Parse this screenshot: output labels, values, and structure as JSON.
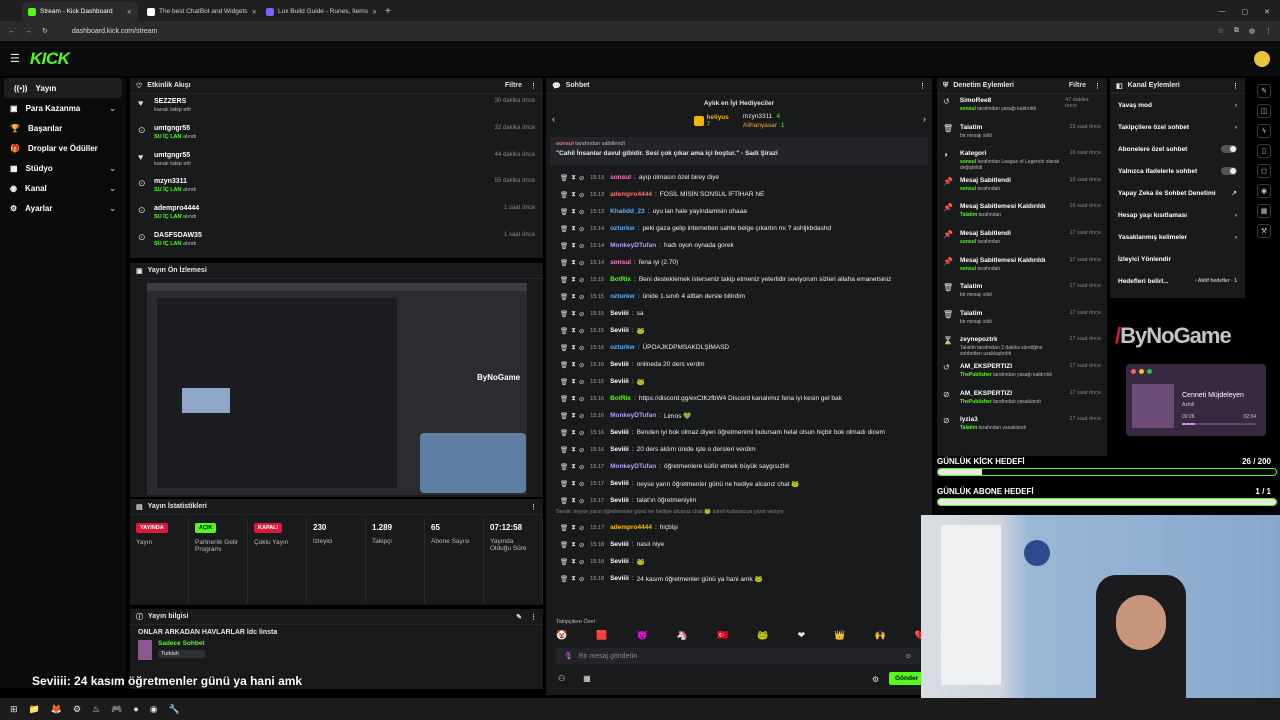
{
  "browser": {
    "tabs": [
      {
        "label": "Stream - Kick Dashboard",
        "color": "#53fc18"
      },
      {
        "label": "The best ChatBot and Widgets",
        "color": "#ffffff"
      },
      {
        "label": "Lux Build Guide - Runes, Items",
        "color": "#7b61ff"
      }
    ],
    "url": "dashboard.kick.com/stream"
  },
  "app": {
    "logo": "KICK"
  },
  "nav": [
    {
      "label": "Yayın",
      "icon": "broadcast-icon",
      "glyph": "((•))",
      "chev": ""
    },
    {
      "label": "Para Kazanma",
      "icon": "money-icon",
      "glyph": "▣",
      "chev": "⌄"
    },
    {
      "label": "Başarılar",
      "icon": "trophy-icon",
      "glyph": "🏆",
      "chev": ""
    },
    {
      "label": "Droplar ve Ödüller",
      "icon": "gift-icon",
      "glyph": "🎁",
      "chev": ""
    },
    {
      "label": "Stüdyo",
      "icon": "studio-icon",
      "glyph": "▦",
      "chev": "⌄"
    },
    {
      "label": "Kanal",
      "icon": "channel-icon",
      "glyph": "◉",
      "chev": "⌄"
    },
    {
      "label": "Ayarlar",
      "icon": "gear-icon",
      "glyph": "⚙",
      "chev": "⌄"
    }
  ],
  "activity": {
    "title": "Etkinlik Akışı",
    "filter": "Filtre",
    "items": [
      {
        "user": "SEZZERS",
        "action": "kanalı takip etti",
        "time": "30 dakika önce",
        "icon": "♥",
        "green": false
      },
      {
        "user": "umtgngr55",
        "action": "SU İÇ LAN",
        "action2": "alındı",
        "time": "32 dakika önce",
        "icon": "⊙",
        "green": true
      },
      {
        "user": "umtgngr55",
        "action": "kanalı takip etti",
        "time": "44 dakika önce",
        "icon": "♥",
        "green": false
      },
      {
        "user": "mzyn3311",
        "action": "SU İÇ LAN",
        "action2": "alındı",
        "time": "55 dakika önce",
        "icon": "⊙",
        "green": true
      },
      {
        "user": "adempro4444",
        "action": "SU İÇ LAN",
        "action2": "alındı",
        "time": "1 saat önce",
        "icon": "⊙",
        "green": true
      },
      {
        "user": "DASFSDAW35",
        "action": "SU İÇ LAN",
        "action2": "alındı",
        "time": "1 saat önce",
        "icon": "⊙",
        "green": true
      }
    ]
  },
  "preview": {
    "title": "Yayın Ön İzlemesi",
    "watermark": "ByNoGame"
  },
  "stats": {
    "title": "Yayın İstatistikleri",
    "boxes": [
      {
        "badge": "YAYINDA",
        "label": "Yayın",
        "color": "red"
      },
      {
        "badge": "AÇIK",
        "label": "Partnerlik Gelir Programı",
        "color": "grn"
      },
      {
        "badge": "KAPALI",
        "label": "Çoklu Yayın",
        "color": "red"
      },
      {
        "value": "230",
        "label": "İzleyici"
      },
      {
        "value": "1.289",
        "label": "Takipçi"
      },
      {
        "value": "65",
        "label": "Abone Sayısı"
      },
      {
        "value": "07:12:58",
        "label": "Yayında Olduğu Süre"
      }
    ]
  },
  "info": {
    "title": "Yayın bilgisi",
    "stream_title": "ONLAR ARKADAN HAVLARLAR ldc linsta",
    "category": "Sadece Sohbet",
    "tag": "Turkish"
  },
  "overlay_chat": {
    "user": "Seviiii",
    "text": ": 24 kasım öğretmenler günü ya hani amk"
  },
  "chat": {
    "title": "Sohbet",
    "gifters_title": "Aylık en İyi Hediyeciler",
    "gifters": [
      {
        "name": "heliyus",
        "value": "7"
      },
      {
        "name": "mzyn3311",
        "value": "4"
      },
      {
        "name": "Alihanyasar",
        "value": "1"
      }
    ],
    "pinned_by": "sonsul",
    "pinned_by_suffix": "tarafından sabitlendi",
    "pinned_msg": "\"Cahil İnsanlar davul gibidir. Sesi çok çıkar ama içi boştur.\" - Sadi Şirazi",
    "messages": [
      {
        "time": "15:13",
        "user": "sonsul",
        "color": "#ff7dd6",
        "msg": "ayıp olmasın özel birey diye"
      },
      {
        "time": "15:13",
        "user": "adempro4444",
        "color": "#ff7070",
        "msg": "FOSİL MİSİN SONSUL İFTİHAR NE"
      },
      {
        "time": "15:13",
        "user": "Khalidd_23",
        "color": "#56b4ff",
        "msg": "uyu lan hale yayindamisin ohaaa"
      },
      {
        "time": "15:14",
        "user": "ozturkw",
        "color": "#56b4ff",
        "msg": "peki gaza gelip internetten sahte belge çıkartın mı ? ashljkbdashd"
      },
      {
        "time": "15:14",
        "user": "MonkeyDTufan",
        "color": "#b79cff",
        "msg": "hadı oyun oynada gorek"
      },
      {
        "time": "15:14",
        "user": "sonsul",
        "color": "#ff7dd6",
        "msg": "fena iyi (2.70)"
      },
      {
        "time": "15:15",
        "user": "BotRix",
        "color": "#53fc18",
        "msg": "Beni desteklemek isterseniz takip etmeniz yeterlidir seviyorum sizleri allaha emanetsiniz"
      },
      {
        "time": "15:15",
        "user": "ozturkw",
        "color": "#56b4ff",
        "msg": "ünide 1.sınıfı 4 alttan dersle bitirdim"
      },
      {
        "time": "15:15",
        "user": "Seviiii",
        "color": "#ffffff",
        "msg": "sa"
      },
      {
        "time": "15:15",
        "user": "Seviiii",
        "color": "#ffffff",
        "msg": "🐸"
      },
      {
        "time": "15:16",
        "user": "ozturkw",
        "color": "#56b4ff",
        "msg": "ÜPOAJKDPMSAKDLŞİMASD"
      },
      {
        "time": "15:16",
        "user": "Seviiii",
        "color": "#ffffff",
        "msg": "onlineda 20 ders verdm"
      },
      {
        "time": "15:16",
        "user": "Seviiii",
        "color": "#ffffff",
        "msg": "🐸"
      },
      {
        "time": "15:16",
        "user": "BotRix",
        "color": "#53fc18",
        "msg": "https://discord.gg/exCtKzfbW4 Discord kanalımız fena iyi kesin gel bak"
      },
      {
        "time": "15:16",
        "user": "MonkeyDTufan",
        "color": "#b79cff",
        "msg": "Limos 💚"
      },
      {
        "time": "15:16",
        "user": "Seviiii",
        "color": "#ffffff",
        "msg": "Benden iyi bok olmaz diyen öğretmenimi bulursam helal olsun hiçbir bok olmadı dicem"
      },
      {
        "time": "15:16",
        "user": "Seviiii",
        "color": "#ffffff",
        "msg": "20 ders aldım ünide işte o dersleri verdim"
      },
      {
        "time": "15:17",
        "user": "MonkeyDTufan",
        "color": "#b79cff",
        "msg": "öğretmenlere küfür etmek büyük saygısızlık"
      },
      {
        "time": "15:17",
        "user": "Seviiii",
        "color": "#ffffff",
        "msg": "neyse yarın öğretmenler günü ne hediye alcanız chat 🐸"
      },
      {
        "time": "15:17",
        "user": "Seviiii",
        "color": "#ffffff",
        "msg": "talat'ın öğretmeniyim"
      }
    ],
    "reply_note": "Seviiii: neyse yarın öğretmenler günü ne hediye alcanız chat 🐸 isimli kullanıcıya yanıt veriyor",
    "messages2": [
      {
        "time": "15:17",
        "user": "adempro4444",
        "color": "#ffbf00",
        "msg": "hiçbişi"
      },
      {
        "time": "15:18",
        "user": "Seviiii",
        "color": "#ffffff",
        "msg": "nasıl niye"
      },
      {
        "time": "15:18",
        "user": "Seviiii",
        "color": "#ffffff",
        "msg": "🐸"
      },
      {
        "time": "15:18",
        "user": "Seviiii",
        "color": "#ffffff",
        "msg": "24 kasım öğretmenler günü ya hani amk 🐸"
      }
    ],
    "followers_only": "Takipçilere Özel",
    "emotes": [
      "🤡",
      "🟥",
      "😈",
      "🦄",
      "🇹🇷",
      "🐸",
      "❤",
      "👑",
      "🙌",
      "💔"
    ],
    "placeholder": "Bir mesaj gönderin",
    "send": "Gönder"
  },
  "mod": {
    "title": "Denetim Eylemleri",
    "filter": "Filtre",
    "items": [
      {
        "user": "SimoRee8",
        "line2": "sonsul",
        "line2b": " tarafından yasağı kaldırıldı",
        "time": "47 dakika önce",
        "icon": "↺"
      },
      {
        "user": "Talatim",
        "line2": "",
        "line2b": "bir mesajı sildi",
        "time": "15 saat önce",
        "icon": "🗑"
      },
      {
        "user": "Kategori",
        "line2": "sonsul",
        "line2b": " tarafından League of Legends olarak değiştirildi",
        "time": "16 saat önce",
        "icon": "◑"
      },
      {
        "user": "Mesaj Sabitlendi",
        "line2": "sonsul",
        "line2b": " tarafından",
        "time": "16 saat önce",
        "icon": "📌"
      },
      {
        "user": "Mesaj Sabitlemesi Kaldırıldı",
        "line2": "Talatim",
        "line2b": " tarafından",
        "time": "16 saat önce",
        "icon": "📌"
      },
      {
        "user": "Mesaj Sabitlendi",
        "line2": "sonsul",
        "line2b": " tarafından",
        "time": "17 saat önce",
        "icon": "📌"
      },
      {
        "user": "Mesaj Sabitlemesi Kaldırıldı",
        "line2": "sonsul",
        "line2b": " tarafından",
        "time": "17 saat önce",
        "icon": "📌"
      },
      {
        "user": "Talatim",
        "line2": "",
        "line2b": "bir mesajı sildi",
        "time": "17 saat önce",
        "icon": "🗑"
      },
      {
        "user": "Talatim",
        "line2": "",
        "line2b": "bir mesajı sildi",
        "time": "17 saat önce",
        "icon": "🗑"
      },
      {
        "user": "zeynepoztrk",
        "line2": "",
        "line2b": "Talatim tarafından 2 dakika süreliğine sohbetten uzaklaştırıldı",
        "time": "17 saat önce",
        "icon": "⌛"
      },
      {
        "user": "AM_EKSPERTIZI",
        "line2": "ThePublisher",
        "line2b": " tarafından yasağı kaldırıldı",
        "time": "17 saat önce",
        "icon": "↺"
      },
      {
        "user": "AM_EKSPERTIZI",
        "line2": "ThePublisher",
        "line2b": " tarafından yasaklandı",
        "time": "17 saat önce",
        "icon": "⊘"
      },
      {
        "user": "lyzia3",
        "line2": "Talatim",
        "line2b": " tarafından yasaklandı",
        "time": "17 saat önce",
        "icon": "⊘"
      }
    ]
  },
  "channel_actions": {
    "title": "Kanal Eylemleri",
    "items": [
      {
        "label": "Yavaş mod",
        "ctrl": "›"
      },
      {
        "label": "Takipçilere özel sohbet",
        "ctrl": "›"
      },
      {
        "label": "Abonelere özel sohbet",
        "ctrl": "toggle"
      },
      {
        "label": "Yalnızca ifadelerle sohbet",
        "ctrl": "toggle"
      },
      {
        "label": "Yapay Zeka ile Sohbet Denetimi",
        "ctrl": "↗"
      },
      {
        "label": "Hesap yaşı kısıtlaması",
        "ctrl": "›"
      },
      {
        "label": "Yasaklanmış kelimeler",
        "ctrl": "›"
      },
      {
        "label": "İzleyici Yönlendir",
        "ctrl": ""
      },
      {
        "label": "Hedefleri belirl...",
        "ctrl": "› Aktif hedefler · 1"
      }
    ]
  },
  "goals": [
    {
      "label": "GÜNLÜK KİCK HEDEFİ",
      "value": "26 / 200",
      "fill": 0.13
    },
    {
      "label": "GÜNLÜK ABONE HEDEFİ",
      "value": "1 / 1",
      "fill": 1.0
    }
  ],
  "music": {
    "title": "Cenneti Müjdeleyen",
    "artist": "Azfoli",
    "start": "00:26",
    "end": "02:34",
    "progress": 0.18
  },
  "overlay_brand": "ByNoGame",
  "taskbar_icons": [
    "⊞",
    "📁",
    "🦊",
    "⚙",
    "♨",
    "🎮",
    "●",
    "◉",
    "🔧"
  ]
}
